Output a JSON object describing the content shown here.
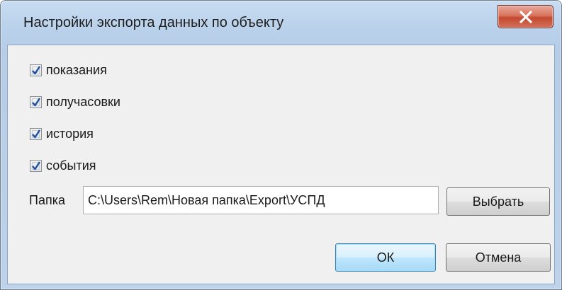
{
  "window": {
    "title": "Настройки экспорта данных по объекту"
  },
  "checkboxes": [
    {
      "label": "показания",
      "checked": true
    },
    {
      "label": "получасовки",
      "checked": true
    },
    {
      "label": "история",
      "checked": true
    },
    {
      "label": "события",
      "checked": true
    }
  ],
  "folder": {
    "label": "Папка",
    "value": "C:\\Users\\Rem\\Новая папка\\Export\\УСПД"
  },
  "buttons": {
    "choose_label": "Выбрать",
    "ok_label": "ОК",
    "cancel_label": "Отмена"
  },
  "icons": {
    "close": "close-icon",
    "check": "checkmark-icon"
  },
  "colors": {
    "close_button": "#c7513a",
    "default_button_border": "#3c7fb1",
    "check_mark": "#1d4e9c"
  }
}
